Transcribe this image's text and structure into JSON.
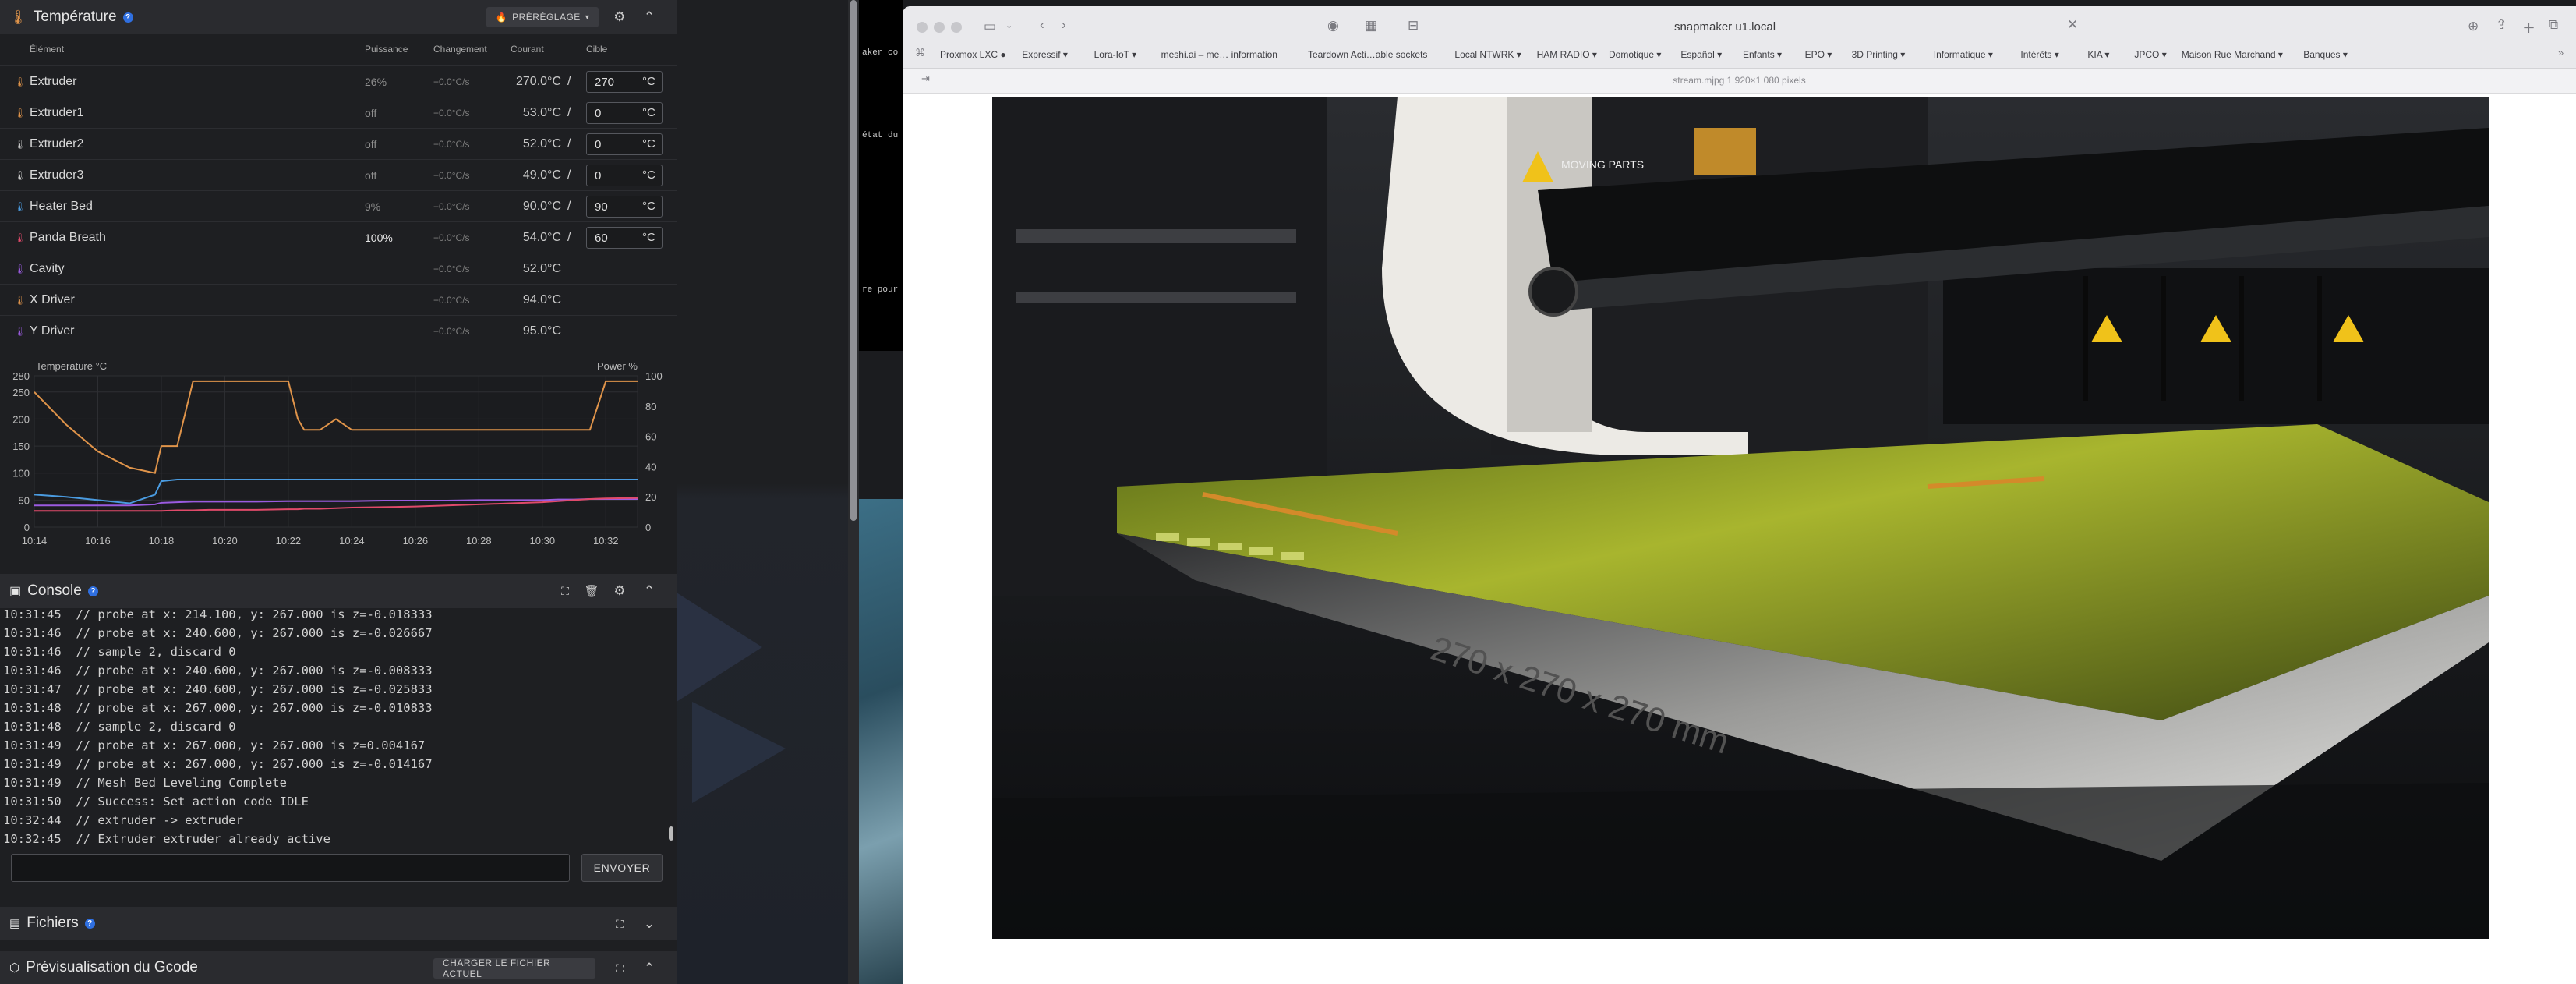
{
  "temperature_panel": {
    "title": "Température",
    "preset_label": "PRÉRÉGLAGE",
    "columns": {
      "element": "Élément",
      "power": "Puissance",
      "change": "Changement",
      "current": "Courant",
      "target": "Cible"
    },
    "rows": [
      {
        "name": "Extruder",
        "power": "26%",
        "power_on": false,
        "change": "+0.0°C/s",
        "current": "270.0°C",
        "target": "270",
        "unit": "°C",
        "icon_color": "#e0944a"
      },
      {
        "name": "Extruder1",
        "power": "off",
        "power_on": false,
        "change": "+0.0°C/s",
        "current": "53.0°C",
        "target": "0",
        "unit": "°C",
        "icon_color": "#e0944a"
      },
      {
        "name": "Extruder2",
        "power": "off",
        "power_on": false,
        "change": "+0.0°C/s",
        "current": "52.0°C",
        "target": "0",
        "unit": "°C",
        "icon_color": "#c9c9c9"
      },
      {
        "name": "Extruder3",
        "power": "off",
        "power_on": false,
        "change": "+0.0°C/s",
        "current": "49.0°C",
        "target": "0",
        "unit": "°C",
        "icon_color": "#c9c9c9"
      },
      {
        "name": "Heater Bed",
        "power": "9%",
        "power_on": false,
        "change": "+0.0°C/s",
        "current": "90.0°C",
        "target": "90",
        "unit": "°C",
        "icon_color": "#4a9be0"
      },
      {
        "name": "Panda Breath",
        "power": "100%",
        "power_on": true,
        "change": "+0.0°C/s",
        "current": "54.0°C",
        "target": "60",
        "unit": "°C",
        "icon_color": "#e04a6a"
      },
      {
        "name": "Cavity",
        "power": "",
        "power_on": false,
        "change": "+0.0°C/s",
        "current": "52.0°C",
        "target": "",
        "unit": "",
        "icon_color": "#9b5be0"
      },
      {
        "name": "X Driver",
        "power": "",
        "power_on": false,
        "change": "+0.0°C/s",
        "current": "94.0°C",
        "target": "",
        "unit": "",
        "icon_color": "#e0944a"
      },
      {
        "name": "Y Driver",
        "power": "",
        "power_on": false,
        "change": "+0.0°C/s",
        "current": "95.0°C",
        "target": "",
        "unit": "",
        "icon_color": "#9b5be0"
      }
    ],
    "separator": "/"
  },
  "chart_data": {
    "type": "line",
    "title": "",
    "ylabel": "Temperature °C",
    "y2label": "Power %",
    "ylim": [
      0,
      280
    ],
    "y2lim": [
      0,
      100
    ],
    "yticks": [
      0,
      50,
      100,
      150,
      200,
      250,
      280
    ],
    "y2ticks": [
      0,
      20,
      40,
      60,
      80,
      100
    ],
    "xticks": [
      "10:14",
      "10:16",
      "10:18",
      "10:20",
      "10:22",
      "10:24",
      "10:26",
      "10:28",
      "10:30",
      "10:32"
    ],
    "x_minutes": [
      14,
      15,
      16,
      17,
      17.8,
      18,
      18.5,
      19,
      19.5,
      20,
      21,
      22,
      22.3,
      22.5,
      23,
      23.5,
      24,
      25,
      26,
      27,
      28,
      29,
      30,
      30.5,
      31,
      31.5,
      32,
      33
    ],
    "series": [
      {
        "color": "#e0944a",
        "values": [
          250,
          190,
          140,
          110,
          100,
          150,
          150,
          270,
          270,
          270,
          270,
          270,
          200,
          180,
          180,
          200,
          180,
          180,
          180,
          180,
          180,
          180,
          180,
          180,
          180,
          180,
          270,
          270
        ]
      },
      {
        "color": "#4a9be0",
        "values": [
          60,
          56,
          50,
          44,
          60,
          85,
          88,
          88,
          88,
          88,
          88,
          88,
          88,
          88,
          88,
          88,
          88,
          88,
          88,
          88,
          88,
          88,
          88,
          88,
          88,
          88,
          88,
          88
        ]
      },
      {
        "color": "#9b5be0",
        "values": [
          40,
          40,
          40,
          40,
          42,
          45,
          46,
          47,
          47,
          47,
          47,
          48,
          48,
          48,
          48,
          48,
          48,
          49,
          49,
          49,
          50,
          50,
          50,
          51,
          51,
          52,
          52,
          52
        ]
      },
      {
        "color": "#e04a6a",
        "values": [
          30,
          30,
          30,
          30,
          30,
          30,
          31,
          31,
          32,
          32,
          32,
          33,
          33,
          34,
          34,
          35,
          36,
          37,
          38,
          40,
          42,
          44,
          46,
          48,
          50,
          52,
          53,
          54
        ]
      }
    ]
  },
  "console": {
    "title": "Console",
    "lines": [
      "10:31:45  // probe at x: 214.100, y: 267.000 is z=-0.018333",
      "10:31:46  // probe at x: 240.600, y: 267.000 is z=-0.026667",
      "10:31:46  // sample 2, discard 0",
      "10:31:46  // probe at x: 240.600, y: 267.000 is z=-0.008333",
      "10:31:47  // probe at x: 240.600, y: 267.000 is z=-0.025833",
      "10:31:48  // probe at x: 267.000, y: 267.000 is z=-0.010833",
      "10:31:48  // sample 2, discard 0",
      "10:31:49  // probe at x: 267.000, y: 267.000 is z=0.004167",
      "10:31:49  // probe at x: 267.000, y: 267.000 is z=-0.014167",
      "10:31:49  // Mesh Bed Leveling Complete",
      "10:31:50  // Success: Set action code IDLE",
      "10:32:44  // extruder -> extruder",
      "10:32:45  // Extruder extruder already active"
    ],
    "input_placeholder": "",
    "send_label": "ENVOYER"
  },
  "files_panel": {
    "title": "Fichiers"
  },
  "gcode_panel": {
    "title": "Prévisualisation du Gcode",
    "load_label": "CHARGER LE FICHIER ACTUEL"
  },
  "terminal_snippets": [
    "aker co",
    "état du",
    "re pour"
  ],
  "browser": {
    "url": "snapmaker u1.local",
    "sub_label": "stream.mjpg 1 920×1 080 pixels",
    "bookmarks": [
      "Proxmox LXC ●",
      "Expressif ▾",
      "Lora-IoT ▾",
      "meshi.ai – me… information",
      "Teardown Acti…able sockets",
      "Local NTWRK ▾",
      "HAM RADIO ▾",
      "Domotique ▾",
      "Español ▾",
      "Enfants ▾",
      "EPO ▾",
      "3D Printing ▾",
      "Informatique ▾",
      "Intérêts ▾",
      "KIA ▾",
      "JPCO ▾",
      "Maison Rue Marchand ▾",
      "Banques ▾"
    ]
  },
  "camera": {
    "label_moving": "MOVING PARTS",
    "bed_text": "270 x 270 x 270 mm"
  }
}
